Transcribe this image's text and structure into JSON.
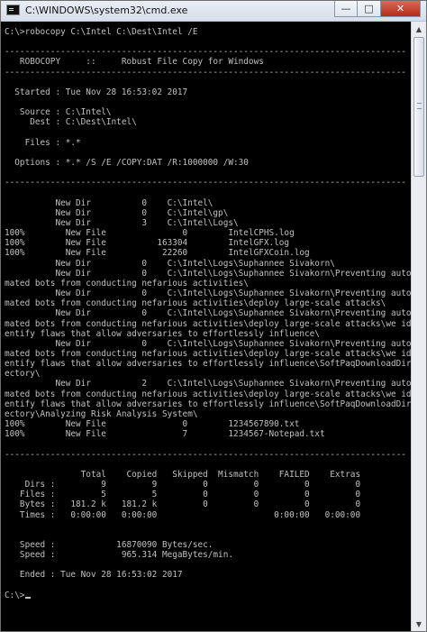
{
  "window": {
    "title": "C:\\WINDOWS\\system32\\cmd.exe",
    "minimize_glyph": "—",
    "maximize_glyph": "□",
    "close_glyph": "✕"
  },
  "console": {
    "lines": [
      "C:\\>robocopy C:\\Intel C:\\Dest\\Intel /E",
      "",
      "-------------------------------------------------------------------------------",
      "   ROBOCOPY     ::     Robust File Copy for Windows",
      "-------------------------------------------------------------------------------",
      "",
      "  Started : Tue Nov 28 16:53:02 2017",
      "",
      "   Source : C:\\Intel\\",
      "     Dest : C:\\Dest\\Intel\\",
      "",
      "    Files : *.*",
      "",
      "  Options : *.* /S /E /COPY:DAT /R:1000000 /W:30",
      "",
      "-------------------------------------------------------------------------------",
      "",
      "          New Dir          0    C:\\Intel\\",
      "          New Dir          0    C:\\Intel\\gp\\",
      "          New Dir          3    C:\\Intel\\Logs\\",
      "100%        New File               0        IntelCPHS.log",
      "100%        New File          163304        IntelGFX.log",
      "100%        New File           22260        IntelGFXCoin.log",
      "          New Dir          0    C:\\Intel\\Logs\\Suphannee Sivakorn\\",
      "          New Dir          0    C:\\Intel\\Logs\\Suphannee Sivakorn\\Preventing auto",
      "mated bots from conducting nefarious activities\\",
      "          New Dir          0    C:\\Intel\\Logs\\Suphannee Sivakorn\\Preventing auto",
      "mated bots from conducting nefarious activities\\deploy large-scale attacks\\",
      "          New Dir          0    C:\\Intel\\Logs\\Suphannee Sivakorn\\Preventing auto",
      "mated bots from conducting nefarious activities\\deploy large-scale attacks\\we id",
      "entify flaws that allow adversaries to effortlessly influence\\",
      "          New Dir          0    C:\\Intel\\Logs\\Suphannee Sivakorn\\Preventing auto",
      "mated bots from conducting nefarious activities\\deploy large-scale attacks\\we id",
      "entify flaws that allow adversaries to effortlessly influence\\SoftPaqDownloadDir",
      "ectory\\",
      "          New Dir          2    C:\\Intel\\Logs\\Suphannee Sivakorn\\Preventing auto",
      "mated bots from conducting nefarious activities\\deploy large-scale attacks\\we id",
      "entify flaws that allow adversaries to effortlessly influence\\SoftPaqDownloadDir",
      "ectory\\Analyzing Risk Analysis System\\",
      "100%        New File               0        1234567890.txt",
      "100%        New File               7        1234567-Notepad.txt",
      "",
      "-------------------------------------------------------------------------------",
      "",
      "               Total    Copied   Skipped  Mismatch    FAILED    Extras",
      "    Dirs :         9         9         0         0         0         0",
      "   Files :         5         5         0         0         0         0",
      "   Bytes :   181.2 k   181.2 k         0         0         0         0",
      "   Times :   0:00:00   0:00:00                       0:00:00   0:00:00",
      "",
      "",
      "   Speed :            16870090 Bytes/sec.",
      "   Speed :             965.314 MegaBytes/min.",
      "",
      "   Ended : Tue Nov 28 16:53:02 2017",
      "",
      "C:\\>"
    ]
  }
}
